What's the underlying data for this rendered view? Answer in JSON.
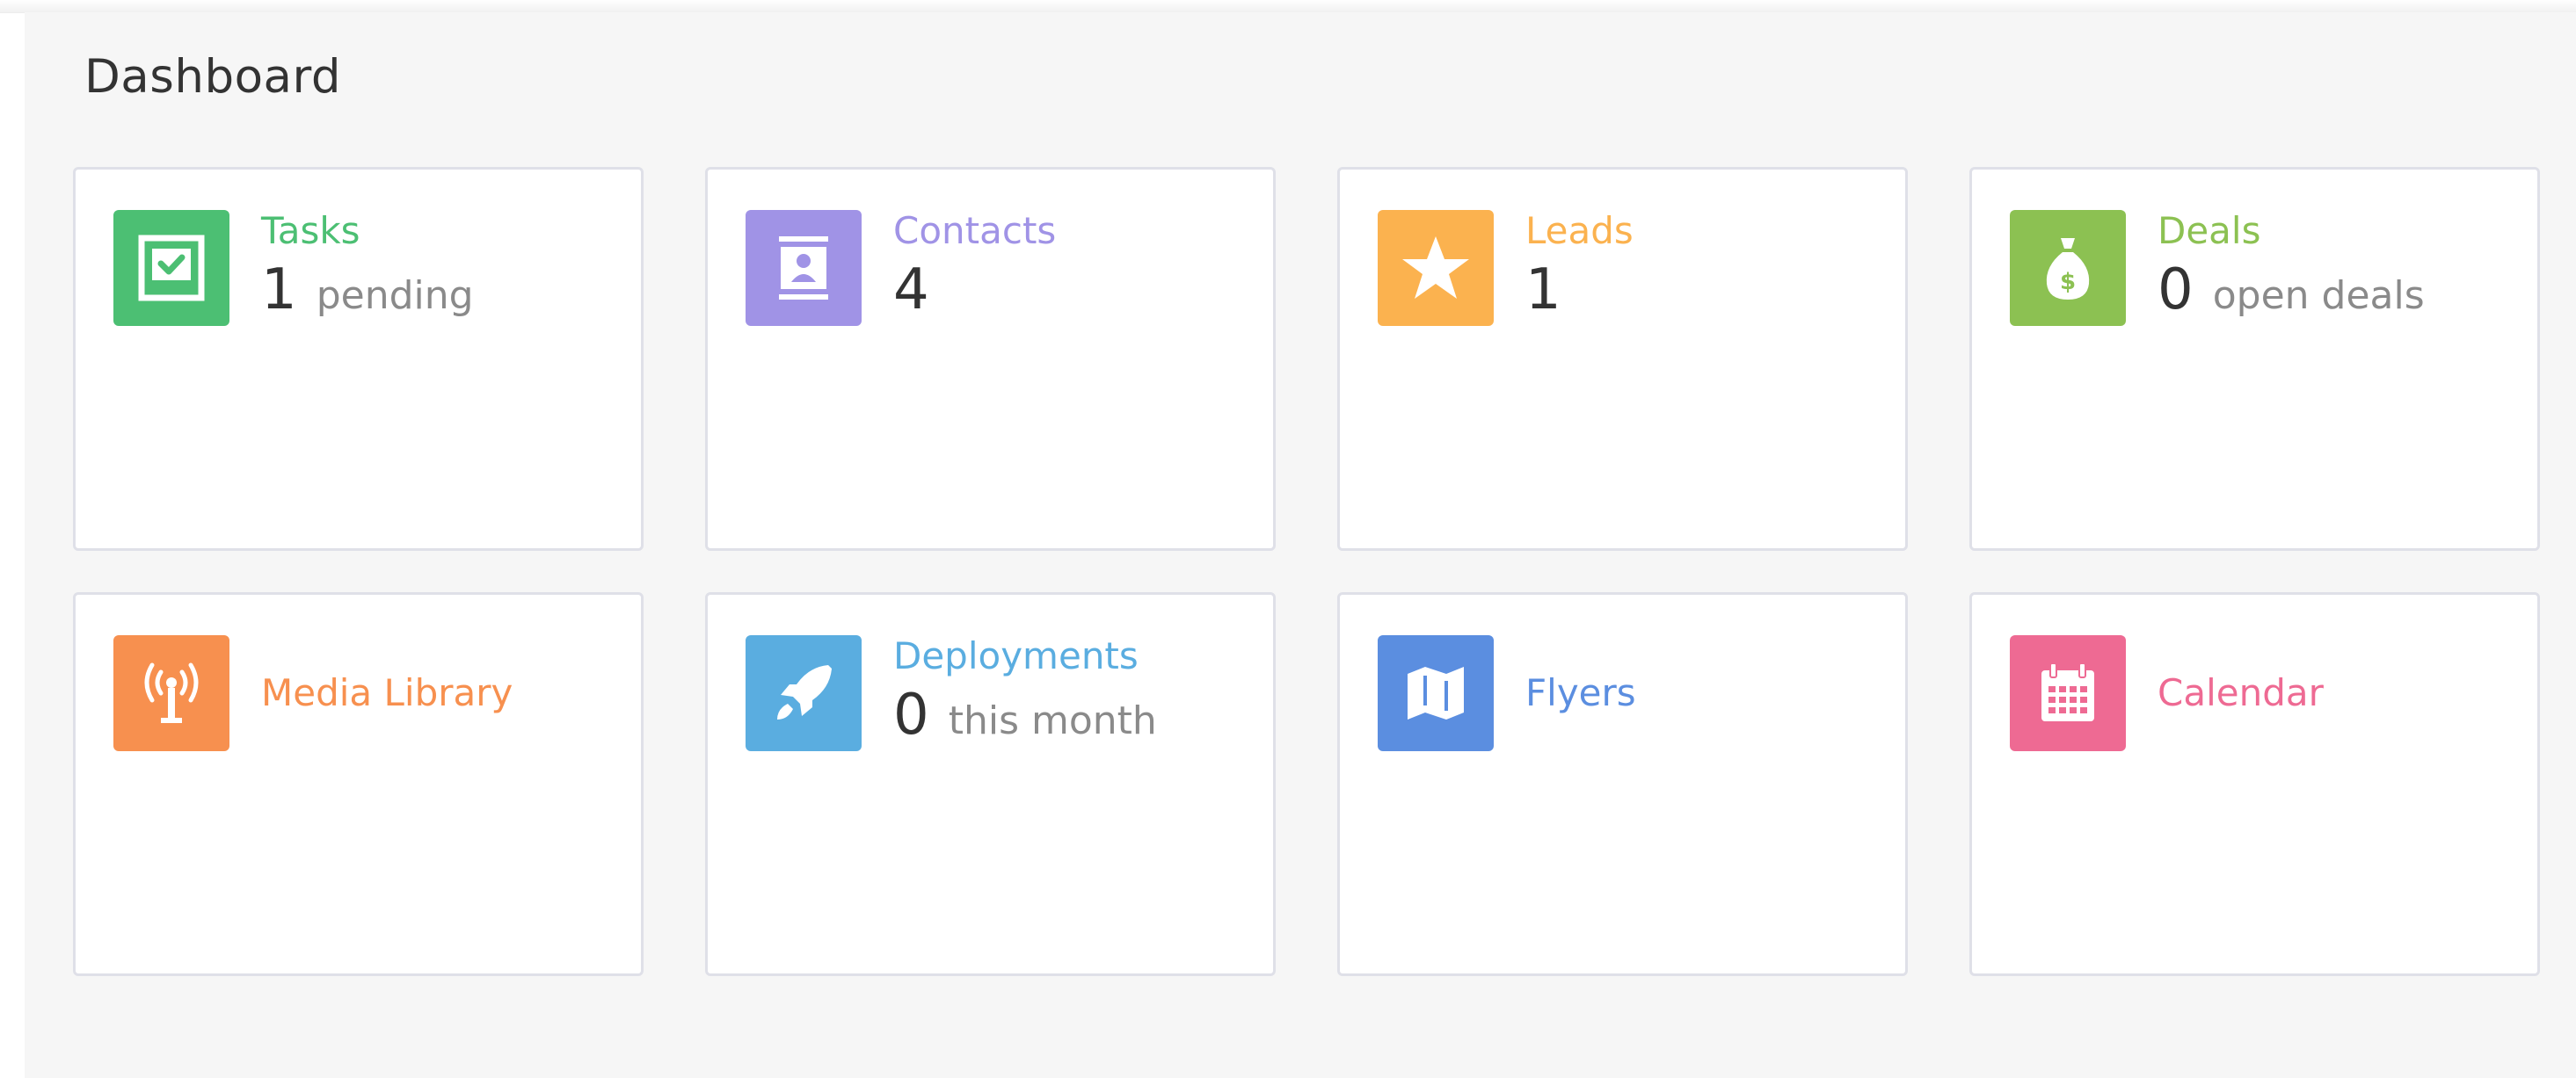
{
  "page": {
    "title": "Dashboard"
  },
  "cards": [
    {
      "title": "Tasks",
      "value": "1",
      "suffix": "pending",
      "color": "#4cbf73",
      "icon": "task-checkbox-icon"
    },
    {
      "title": "Contacts",
      "value": "4",
      "suffix": "",
      "color": "#a093e6",
      "icon": "contact-book-icon"
    },
    {
      "title": "Leads",
      "value": "1",
      "suffix": "",
      "color": "#fbb24f",
      "icon": "star-icon"
    },
    {
      "title": "Deals",
      "value": "0",
      "suffix": "open deals",
      "color": "#8cc152",
      "icon": "money-bag-icon"
    },
    {
      "title": "Media Library",
      "color": "#f7904f",
      "icon": "broadcast-antenna-icon"
    },
    {
      "title": "Deployments",
      "value": "0",
      "suffix": "this month",
      "color": "#5aade0",
      "icon": "rocket-icon"
    },
    {
      "title": "Flyers",
      "color": "#5b8ee0",
      "icon": "map-icon"
    },
    {
      "title": "Calendar",
      "color": "#ee6a93",
      "icon": "calendar-icon"
    }
  ]
}
